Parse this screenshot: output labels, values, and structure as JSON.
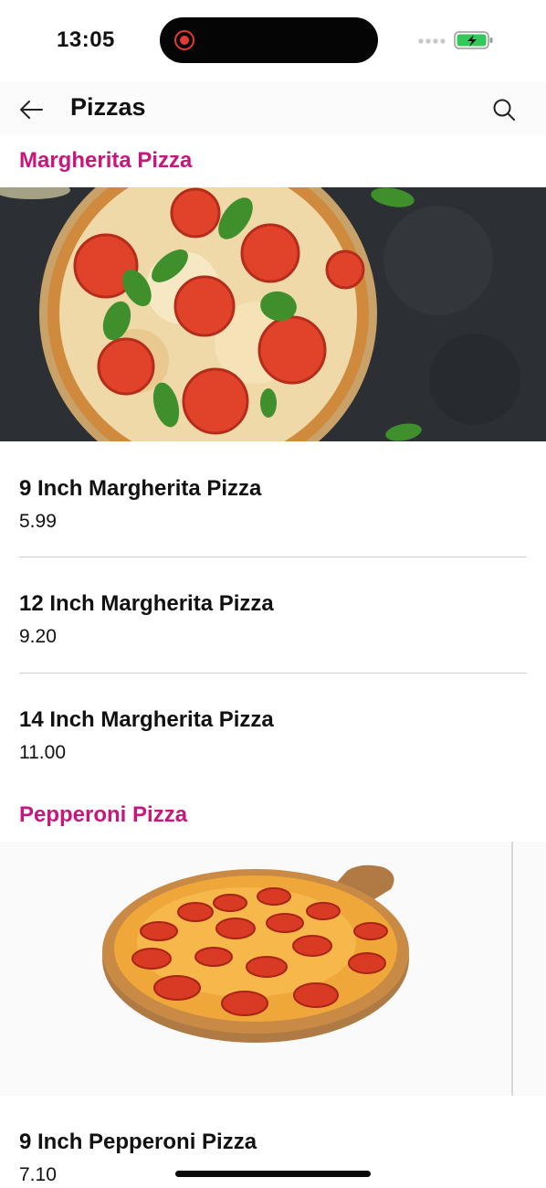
{
  "status_bar": {
    "time": "13:05",
    "colors": {
      "record": "#e53935",
      "battery_fill": "#34c759"
    }
  },
  "header": {
    "back_icon": "arrow-left-icon",
    "title": "Pizzas",
    "search_icon": "search-icon"
  },
  "sections": [
    {
      "title": "Margherita Pizza",
      "image": "margherita-pizza-photo",
      "items": [
        {
          "name": "9 Inch Margherita Pizza",
          "price": "5.99"
        },
        {
          "name": "12 Inch Margherita Pizza",
          "price": "9.20"
        },
        {
          "name": "14 Inch Margherita Pizza",
          "price": "11.00"
        }
      ]
    },
    {
      "title": "Pepperoni Pizza",
      "image": "pepperoni-pizza-photo",
      "items": [
        {
          "name": "9 Inch Pepperoni Pizza",
          "price": "7.10"
        }
      ]
    }
  ],
  "theme": {
    "accent": "#c8177a"
  }
}
